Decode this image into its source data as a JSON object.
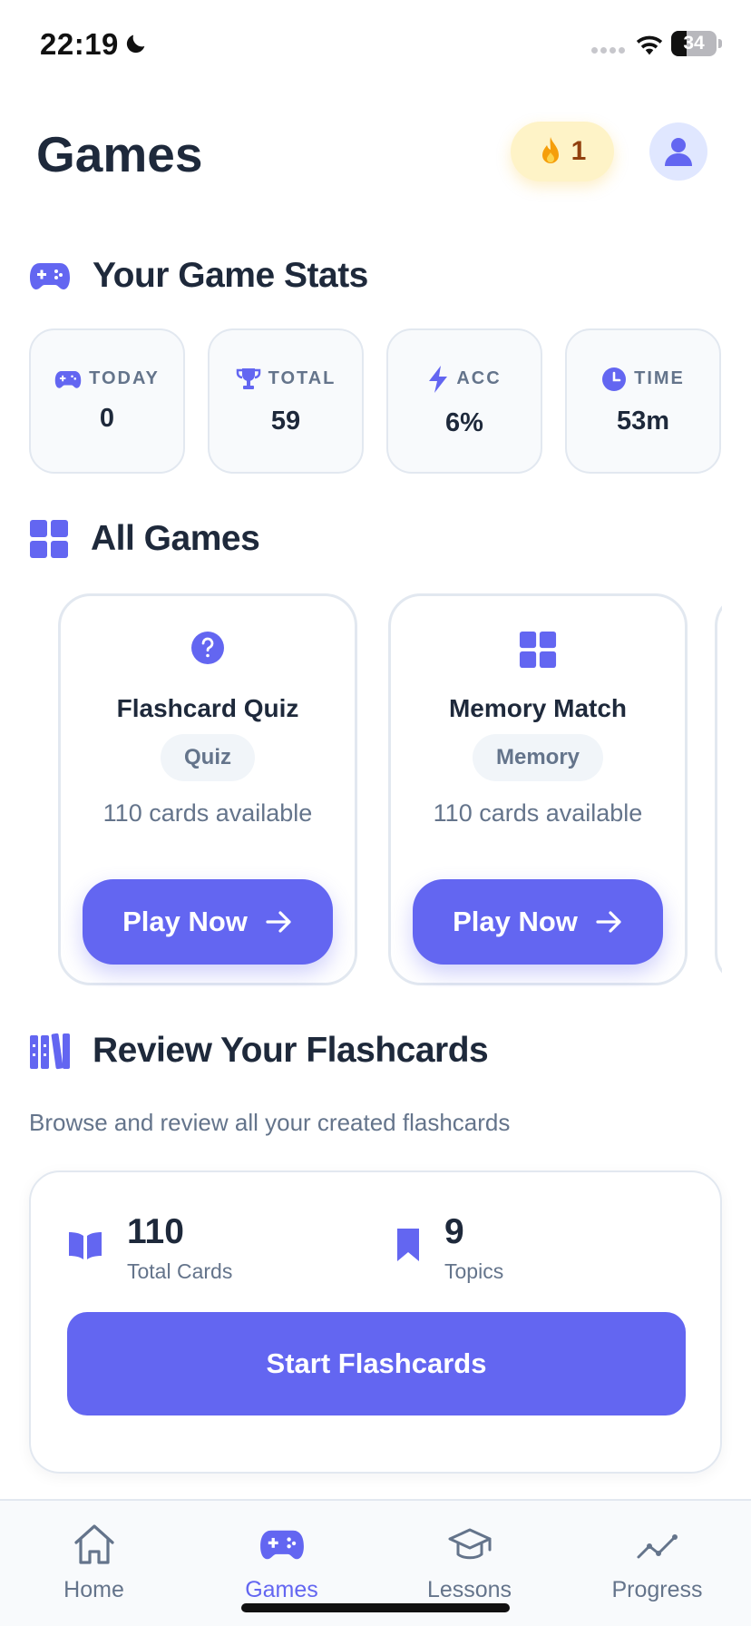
{
  "status_bar": {
    "time": "22:19",
    "battery": "34"
  },
  "header": {
    "title": "Games",
    "streak_count": "1"
  },
  "stats_section": {
    "title": "Your Game Stats",
    "cards": [
      {
        "label": "TODAY",
        "value": "0",
        "icon": "gamepad-icon"
      },
      {
        "label": "TOTAL",
        "value": "59",
        "icon": "trophy-icon"
      },
      {
        "label": "ACC",
        "value": "6%",
        "icon": "lightning-icon"
      },
      {
        "label": "TIME",
        "value": "53m",
        "icon": "clock-icon"
      }
    ]
  },
  "games_section": {
    "title": "All Games",
    "games": [
      {
        "name": "Flashcard Quiz",
        "tag": "Quiz",
        "count": "110 cards available",
        "button": "Play Now",
        "icon": "question-circle-icon"
      },
      {
        "name": "Memory Match",
        "tag": "Memory",
        "count": "110 cards available",
        "button": "Play Now",
        "icon": "grid-icon"
      }
    ]
  },
  "review_section": {
    "title": "Review Your Flashcards",
    "subtitle": "Browse and review all your created flashcards",
    "total_cards": {
      "value": "110",
      "label": "Total Cards"
    },
    "topics": {
      "value": "9",
      "label": "Topics"
    },
    "button": "Start Flashcards"
  },
  "tab_bar": {
    "tabs": [
      {
        "label": "Home",
        "icon": "home-icon"
      },
      {
        "label": "Games",
        "icon": "gamepad-icon",
        "active": true
      },
      {
        "label": "Lessons",
        "icon": "graduation-cap-icon"
      },
      {
        "label": "Progress",
        "icon": "trend-line-icon"
      }
    ]
  },
  "colors": {
    "accent": "#6366f1",
    "text": "#1e293b",
    "muted": "#64748b",
    "streak_bg": "#fef3c7"
  }
}
